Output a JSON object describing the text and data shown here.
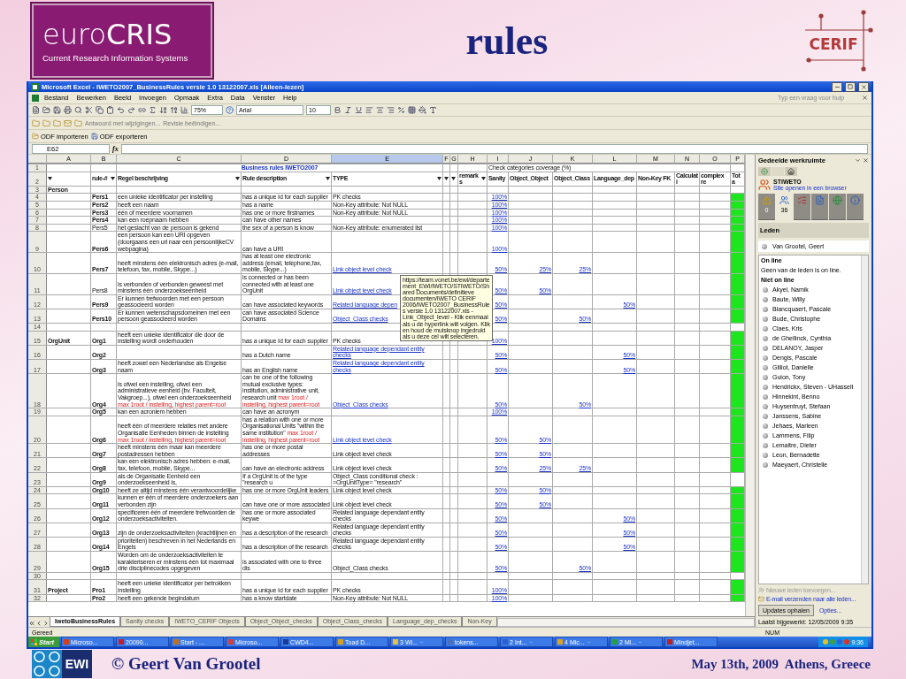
{
  "slide": {
    "logo": {
      "name": "euro**CRIS**",
      "subtitle": "Current Research Information Systems"
    },
    "title": "rules",
    "cerif": "CERIF"
  },
  "excel": {
    "title": "Microsoft Excel - IWETO2007_BusinessRules versie 1.0 13122007.xls  [Alleen-lezen]",
    "menu": [
      "Bestand",
      "Bewerken",
      "Beeld",
      "Invoegen",
      "Opmaak",
      "Extra",
      "Data",
      "Venster",
      "Help"
    ],
    "help_placeholder": "Typ een vraag voor hulp",
    "toolbar": {
      "zoom": "75%",
      "font": "Arial",
      "size": "10"
    },
    "review_toolbar": [
      "Antwoord met wijzigingen...",
      "Revisie beëindigen..."
    ],
    "odf_toolbar": [
      "ODF importeren",
      "ODF exporteren"
    ],
    "name_box": "E62",
    "formula_label": "fx",
    "columns": [
      {
        "label": "A",
        "selected": false
      },
      {
        "label": "B",
        "selected": false
      },
      {
        "label": "C",
        "selected": false
      },
      {
        "label": "D",
        "selected": false
      },
      {
        "label": "E",
        "selected": true
      },
      {
        "label": "F",
        "selected": false
      },
      {
        "label": "G",
        "selected": false
      },
      {
        "label": "H",
        "selected": false
      },
      {
        "label": "I",
        "selected": false
      },
      {
        "label": "J",
        "selected": false
      },
      {
        "label": "K",
        "selected": false
      },
      {
        "label": "L",
        "selected": false
      },
      {
        "label": "M",
        "selected": false
      },
      {
        "label": "N",
        "selected": false
      },
      {
        "label": "O",
        "selected": false
      },
      {
        "label": "P",
        "selected": false
      }
    ],
    "sheet": {
      "title_row": "1",
      "title": "Business rules IWETO2007",
      "coverage_title": "Check categories coverage (%)",
      "header_row": "2",
      "headers": {
        "b": "rule-#",
        "c": "Regel beschrijving",
        "d": "Rule description",
        "e": "TYPE",
        "h": "remarks",
        "i": "Sanity",
        "j": "Object_Object",
        "k": "Object_Class",
        "l": "Language_dep",
        "m": "Non-Key FK",
        "n": "Calculati",
        "o": "complex re",
        "p": "Tota"
      },
      "rows": [
        {
          "row": "3",
          "group": "Person",
          "total_ok": false
        },
        {
          "row": "4",
          "rule": "Pers1",
          "rule_bold": true,
          "nl": "een unieke identificator per instelling",
          "en": "has a unique Id for each supplier",
          "type": "PK checks",
          "type_link": false,
          "coverage": {
            "i": "100%"
          },
          "total_ok": true
        },
        {
          "row": "5",
          "rule": "Pers2",
          "rule_bold": true,
          "nl": "heeft een naam",
          "en": "has a name",
          "type": "Non-Key attribute: Not NULL",
          "type_link": false,
          "coverage": {
            "i": "100%"
          },
          "total_ok": true
        },
        {
          "row": "6",
          "rule": "Pers3",
          "rule_bold": true,
          "nl": "één of meerdere voornamen",
          "en": "has one or more firstnames",
          "type": "Non-Key attribute: Not NULL",
          "type_link": false,
          "coverage": {
            "i": "100%"
          },
          "total_ok": true
        },
        {
          "row": "7",
          "rule": "Pers4",
          "rule_bold": true,
          "nl": "kan een roepnaam hebben",
          "en": "can have other names",
          "coverage": {
            "i": "100%"
          },
          "total_ok": true
        },
        {
          "row": "8",
          "rule": "Pers5",
          "rule_bold": false,
          "nl": "het geslacht van de persoon is gekend",
          "en": "the sex of a person is know",
          "type": "Non-Key attribute: enumerated list",
          "type_link": false,
          "coverage": {
            "i": "100%"
          },
          "total_ok": true
        },
        {
          "row": "9",
          "rule": "Pers6",
          "rule_bold": true,
          "nl": "een persoon kan een URI opgeven (doorgaans een url naar een persoonlijkeCV webpagina)",
          "en": "can have a URI",
          "coverage": {
            "i": "100%"
          },
          "total_ok": true
        },
        {
          "row": "10",
          "rule": "Pers7",
          "rule_bold": true,
          "nl": "heeft minstens één elektronisch adres (e-mail, telefoon, fax, mobile, Skype...)",
          "en": "has at least one electronic address (email, telephone,fax, mobile, Skype...)",
          "type": "Link object level check",
          "type_link": true,
          "coverage": {
            "i": "50%",
            "j": "25%",
            "k": "25%"
          },
          "total_ok": true
        },
        {
          "row": "11",
          "rule": "Pers8",
          "rule_bold": false,
          "nl": "is verbonden of verbonden geweest met minstens één onderzoekseenheid",
          "en": "is connected or has been connected with at least one OrgUnit",
          "type": "Link object level check",
          "type_link": true,
          "coverage": {
            "i": "50%",
            "j": "50%"
          },
          "total_ok": true,
          "tooltip": "https://team.vonet.be/ewi/departement_EWI/IWETO/STIWETO/Shared Documents/definitieve documenten/IWETO CERIF 2006/IWETO2007_BusinessRules versie 1.0 13122007.xls - Link_Object_level - Klik eenmaal als u de hyperlink wilt volgen. Klik en houd de muisknop ingedrukt als u deze cel wilt selecteren."
        },
        {
          "row": "12",
          "rule": "Pers9",
          "rule_bold": true,
          "nl": "Er kunnen trefwoorden met een persoon geassocieerd worden",
          "en": "can have associated keywords",
          "type": "Related language depen",
          "type_link": true,
          "coverage": {
            "i": "50%",
            "l": "50%"
          },
          "total_ok": true
        },
        {
          "row": "13",
          "rule": "Pers10",
          "rule_bold": true,
          "nl": "Er kunnen wetenschapsdomeinen met een persoon geassocieerd worden",
          "en": "can have associated Science Domains",
          "type": "Object_Class checks",
          "type_link": true,
          "coverage": {
            "i": "50%",
            "k": "50%"
          },
          "total_ok": true
        },
        {
          "row": "14",
          "total_ok": false
        },
        {
          "row": "15",
          "group": "OrgUnit",
          "rule": "Org1",
          "rule_bold": true,
          "nl": "heeft een unieke identificator die door de instelling wordt onderhouden",
          "en": "has a unique Id for each supplier",
          "type": "PK checks",
          "type_link": false,
          "coverage": {
            "i": "100%"
          },
          "total_ok": true
        },
        {
          "row": "16",
          "rule": "Org2",
          "rule_bold": true,
          "en": "has a Dutch name",
          "type": "Related language dependant entity checks",
          "type_link": true,
          "coverage": {
            "i": "50%",
            "l": "50%"
          },
          "total_ok": true
        },
        {
          "row": "17",
          "rule": "Org3",
          "rule_bold": true,
          "nl": "heeft zowel een Nederlandse als Engelse naam",
          "en": "has an English name",
          "type": "Related language dependant entity checks",
          "type_link": true,
          "coverage": {
            "i": "50%",
            "l": "50%"
          },
          "total_ok": true
        },
        {
          "row": "18",
          "rule": "Org4",
          "rule_bold": true,
          "nl": "is ofwel een instelling, ofwel een administratieve eenheid (bv. Faculteit, Vakgroep...), ofwel een onderzoekseenheid",
          "nl_note": "max 1root / instelling, highest parent=root",
          "en": "can be one of the following mutual exclusive types: institution, administrative unit, research unit",
          "en_note": "max 1root / instelling, highest parent=root",
          "type": "Object_Class checks",
          "type_link": true,
          "coverage": {
            "i": "50%",
            "k": "50%"
          },
          "total_ok": true
        },
        {
          "row": "19",
          "rule": "Org5",
          "rule_bold": true,
          "nl": "kan een acroniem hebben",
          "en": "can have an acronym",
          "coverage": {
            "i": "100%"
          },
          "total_ok": true
        },
        {
          "row": "20",
          "rule": "Org6",
          "rule_bold": true,
          "nl": "heeft één of meerdere relaties met andere Organisatie Eenheden binnen de instelling",
          "nl_note": "max 1root / instelling, highest parent=root",
          "en": "has a relation with one or more Organisational Units \"within the same institution\"",
          "en_note": "max 1root / instelling, highest parent=root",
          "type": "Link object level check",
          "type_link": true,
          "coverage": {
            "i": "50%",
            "j": "50%"
          },
          "total_ok": true
        },
        {
          "row": "21",
          "rule": "Org7",
          "rule_bold": true,
          "nl": "heeft minstens één maar kan meerdere postadressen hebben",
          "en": "has one or more postal addresses",
          "type": "Link object level check",
          "type_link": false,
          "coverage": {
            "i": "50%",
            "j": "50%"
          },
          "total_ok": true
        },
        {
          "row": "22",
          "rule": "Org8",
          "rule_bold": true,
          "nl": "kan een elektronisch adres hebben: e-mail, fax, telefoon, mobile, Skype...",
          "en": "can have an electronic address",
          "type": "Link object level check",
          "type_link": false,
          "coverage": {
            "i": "50%",
            "j": "25%",
            "k": "25%"
          },
          "total_ok": true
        },
        {
          "row": "23",
          "rule": "Org9",
          "rule_bold": true,
          "nl": "als de Organisatie Eenheid een onderzoekseenheid is,",
          "en": "If a OrgUnit is of the type \"research u",
          "type": "Object_Class conditional check : =OrgUnitType= \"research\"",
          "type_link": false,
          "total_ok": false
        },
        {
          "row": "24",
          "rule": "Org10",
          "rule_bold": true,
          "nl": "heeft ze altijd minstens één verantwoordelijke",
          "en": "has one or more OrgUnit leaders",
          "type": "Link object level check",
          "type_link": false,
          "coverage": {
            "i": "50%",
            "j": "50%"
          },
          "total_ok": true
        },
        {
          "row": "25",
          "rule": "Org11",
          "rule_bold": true,
          "nl": "kunnen er één of meerdere onderzoekers aan verbonden zijn",
          "en": "can have one or more associated",
          "type": "Link object level check",
          "type_link": false,
          "coverage": {
            "i": "50%",
            "j": "50%"
          },
          "total_ok": true
        },
        {
          "row": "26",
          "rule": "Org12",
          "rule_bold": true,
          "nl": "specificeren één of meerdere trefwoorden de onderzoeksactiviteiten.",
          "en": "has one or more associated keywe",
          "type": "Related language dependant entity checks",
          "type_link": false,
          "coverage": {
            "i": "50%",
            "l": "50%"
          },
          "total_ok": true
        },
        {
          "row": "27",
          "rule": "Org13",
          "rule_bold": true,
          "nl": "zijn de onderzoeksactiviteiten (krachtlijnen en",
          "en": "has a description of the research",
          "type": "Related language dependant entity checks",
          "type_link": false,
          "coverage": {
            "i": "50%",
            "l": "50%"
          },
          "total_ok": true
        },
        {
          "row": "28",
          "rule": "Org14",
          "rule_bold": true,
          "nl": "prioriteiten) beschreven in het Nederlands en Engels",
          "en": "has a description of the research",
          "type": "Related language dependant entity checks",
          "type_link": false,
          "coverage": {
            "i": "50%",
            "l": "50%"
          },
          "total_ok": true
        },
        {
          "row": "29",
          "rule": "Org15",
          "rule_bold": true,
          "nl": "Worden om de onderzoeksactiviteiten te karakteriseren er minstens één tot maximaal drie disciplinecodes opgegeven",
          "en": "is associated with one to three dis",
          "type": "Object_Class checks",
          "type_link": false,
          "coverage": {
            "i": "50%",
            "k": "50%"
          },
          "total_ok": true
        },
        {
          "row": "30",
          "total_ok": false
        },
        {
          "row": "31",
          "group": "Project",
          "rule": "Pro1",
          "rule_bold": true,
          "nl": "heeft een unieke identificator per betrokken instelling",
          "en": "has a unique Id for each supplier",
          "type": "PK checks",
          "type_link": false,
          "coverage": {
            "i": "100%"
          },
          "total_ok": true
        },
        {
          "row": "32",
          "rule": "Pro2",
          "rule_bold": true,
          "nl": "heeft een gekende begindatum",
          "en": "has a know startdate",
          "type": "Non-Key attribute: Not NULL",
          "type_link": false,
          "coverage": {
            "i": "100%"
          },
          "total_ok": true
        }
      ]
    },
    "sheet_tabs": [
      {
        "label": "IwetoBusinessRules",
        "selected": true
      },
      {
        "label": "Sanity checks",
        "selected": false
      },
      {
        "label": "IWETO_CERIF Objects",
        "selected": false
      },
      {
        "label": "Object_Object_checks",
        "selected": false
      },
      {
        "label": "Object_Class_checks",
        "selected": false
      },
      {
        "label": "Language_dep_checks",
        "selected": false
      },
      {
        "label": "Non-Key",
        "selected": false
      }
    ],
    "status": "Gereed",
    "status_num": "NUM"
  },
  "task_pane": {
    "title": "Gedeelde werkruimte",
    "site": "STIWETO",
    "site_link": "Site openen in een browser",
    "tabs": [
      {
        "kind": "warning",
        "count": "0",
        "selected": false
      },
      {
        "kind": "members",
        "count": "36",
        "selected": true
      },
      {
        "kind": "tasks",
        "selected": false
      },
      {
        "kind": "documents",
        "selected": false
      },
      {
        "kind": "links",
        "selected": false
      },
      {
        "kind": "info",
        "selected": false
      }
    ],
    "section": "Leden",
    "current_user": "Van Grootel, Geert",
    "online_heading": "On line",
    "online_note": "Geen van de leden is on line.",
    "offline_heading": "Niet on line",
    "members": [
      "Akyel, Namik",
      "Baute, Willy",
      "Blancquaert, Pascale",
      "Bude, Christophe",
      "Claes, Kris",
      "de Ghellinck, Cynthia",
      "DELANOY, Jasper",
      "Dengis, Pascale",
      "Gilliot, Danielle",
      "Guion, Tony",
      "Hendrickx, Steven - UHasselt",
      "Hinnekint, Benno",
      "Huysentruyt, Stefaan",
      "Janssens, Sabine",
      "Jehaes, Marleen",
      "Lammens, Filip",
      "Lemaitre, Dieter",
      "Leon, Bernadette",
      "Maeyaert, Christelle"
    ],
    "add_members": {
      "label": "Nieuwe leden toevoegen...",
      "disabled": true
    },
    "email_all": "E-mail verzenden naar alle leden...",
    "update_button": "Updates ophalen",
    "options": "Opties...",
    "last_updated": "Laatst bijgewerkt: 12/05/2009 9:35"
  },
  "taskbar": {
    "start": "Start",
    "items": [
      {
        "label": "Microso...",
        "color": "#d04020",
        "grouped": false
      },
      {
        "label": "20090...",
        "color": "#c02030",
        "grouped": false
      },
      {
        "label": "Start - ...",
        "color": "#c07020",
        "grouped": false
      },
      {
        "label": "Microso...",
        "color": "#d04040",
        "grouped": false
      },
      {
        "label": "CWD4...",
        "color": "#1a3a9a",
        "grouped": false
      },
      {
        "label": "Toad D...",
        "color": "#d8a020",
        "grouped": false
      },
      {
        "label": "3 Wi...",
        "color": "#e8c040",
        "grouped": true
      },
      {
        "label": "tokens...",
        "color": "#4a70c0",
        "grouped": false
      },
      {
        "label": "2 Int...",
        "color": "#2a60d0",
        "grouped": true
      },
      {
        "label": "4 Mic...",
        "color": "#e0a020",
        "grouped": true
      },
      {
        "label": "2 Mi...",
        "color": "#20a040",
        "grouped": true
      },
      {
        "label": "Mindjet...",
        "color": "#c02020",
        "grouped": false
      }
    ],
    "clock": "9:36"
  },
  "footer": {
    "logo": "EWI",
    "author": "© Geert Van Grootel",
    "date": "May 13th, 2009  Athens, Greece"
  }
}
